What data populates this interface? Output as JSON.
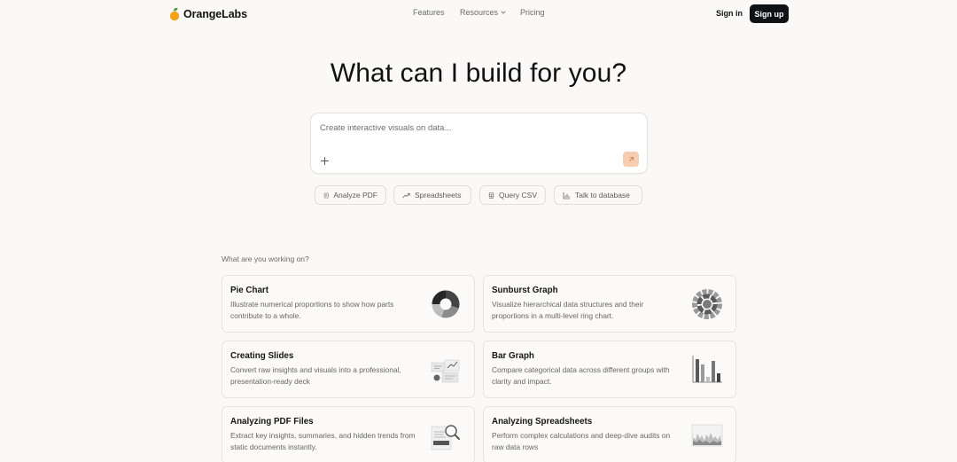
{
  "brand": {
    "name": "OrangeLabs",
    "accent": "#f5a21b",
    "leaf": "#4a9a3a"
  },
  "nav": {
    "links": [
      {
        "label": "Features"
      },
      {
        "label": "Resources",
        "has_dropdown": true
      },
      {
        "label": "Pricing"
      }
    ],
    "signin_label": "Sign in",
    "signup_label": "Sign up"
  },
  "hero": {
    "title": "What can I build for you?",
    "prompt_placeholder": "Create interactive visuals on data...",
    "send_icon": "arrow-up-right-icon",
    "add_icon": "plus-icon"
  },
  "chips": [
    {
      "label": "Analyze PDF",
      "icon": "document-icon"
    },
    {
      "label": "Spreadsheets",
      "icon": "trend-up-icon"
    },
    {
      "label": "Query CSV",
      "icon": "table-icon"
    },
    {
      "label": "Talk to database",
      "icon": "bar-chart-icon"
    }
  ],
  "section": {
    "label": "What are you working on?",
    "cards": [
      {
        "title": "Pie Chart",
        "desc": "Illustrate numerical proportions to show how parts contribute to a whole.",
        "icon": "donut-chart-icon"
      },
      {
        "title": "Sunburst Graph",
        "desc": "Visualize hierarchical data structures and their proportions in a multi-level ring chart.",
        "icon": "sunburst-icon"
      },
      {
        "title": "Creating Slides",
        "desc": "Convert raw insights and visuals into a professional, presentation-ready deck",
        "icon": "slides-icon"
      },
      {
        "title": "Bar Graph",
        "desc": "Compare categorical data across different groups with clarity and impact.",
        "icon": "bar-graph-icon"
      },
      {
        "title": "Analyzing PDF Files",
        "desc": "Extract key insights, summaries, and hidden trends from static documents instantly.",
        "icon": "magnifier-doc-icon"
      },
      {
        "title": "Analyzing Spreadsheets",
        "desc": "Perform complex calculations and deep-dive audits on raw data rows",
        "icon": "area-chart-icon"
      }
    ]
  }
}
